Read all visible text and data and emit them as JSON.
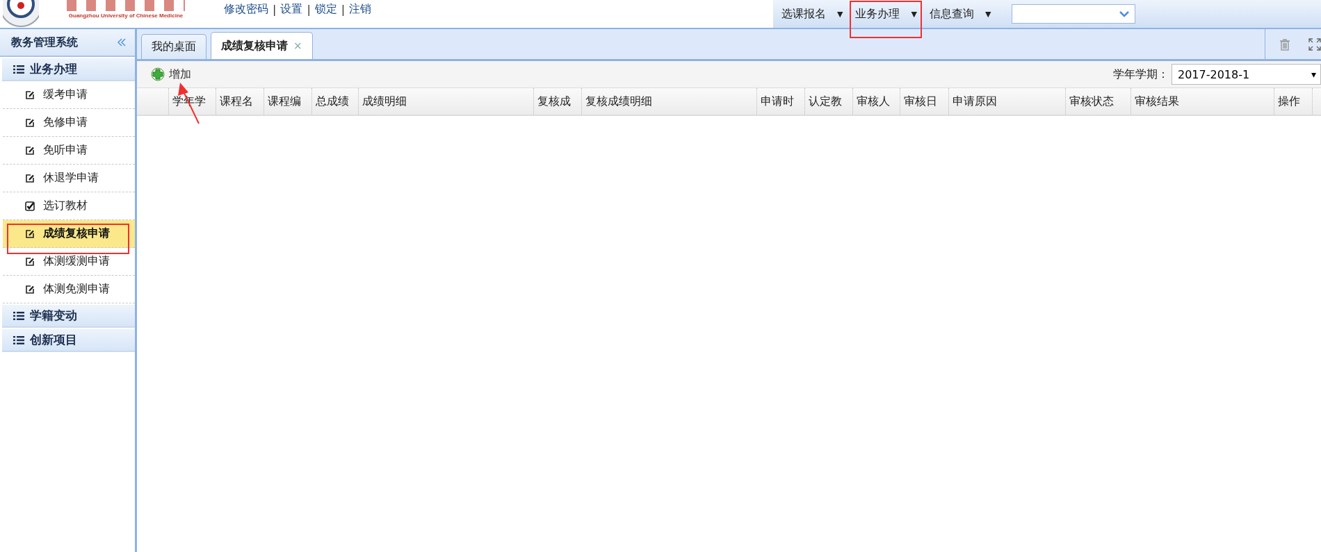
{
  "header": {
    "logo_subtitle": "Guangzhou University of Chinese Medicine",
    "links": [
      "修改密码",
      "设置",
      "锁定",
      "注销"
    ],
    "link_separator": "|",
    "menus": [
      {
        "label": "选课报名",
        "caret": "▼"
      },
      {
        "label": "业务办理",
        "caret": "▼"
      },
      {
        "label": "信息查询",
        "caret": "▼"
      }
    ]
  },
  "sidebar": {
    "title": "教务管理系统",
    "groups": [
      {
        "label": "业务办理",
        "items": [
          {
            "label": "缓考申请",
            "kind": "edit",
            "selected": false
          },
          {
            "label": "免修申请",
            "kind": "edit",
            "selected": false
          },
          {
            "label": "免听申请",
            "kind": "edit",
            "selected": false
          },
          {
            "label": "休退学申请",
            "kind": "edit",
            "selected": false
          },
          {
            "label": "选订教材",
            "kind": "check",
            "selected": false
          },
          {
            "label": "成绩复核申请",
            "kind": "edit",
            "selected": true
          },
          {
            "label": "体测缓测申请",
            "kind": "edit",
            "selected": false
          },
          {
            "label": "体测免测申请",
            "kind": "edit",
            "selected": false
          }
        ]
      },
      {
        "label": "学籍变动"
      },
      {
        "label": "创新项目"
      }
    ]
  },
  "tabs": [
    {
      "label": "我的桌面",
      "selected": false
    },
    {
      "label": "成绩复核申请",
      "selected": true,
      "close": "×"
    }
  ],
  "toolbar": {
    "add_button": "增加",
    "term_label": "学年学期：",
    "term_value": "2017-2018-1",
    "term_caret": "▾"
  },
  "table": {
    "columns": [
      "学年学",
      "课程名",
      "课程编",
      "总成绩",
      "成绩明细",
      "复核成",
      "复核成绩明细",
      "申请时",
      "认定教",
      "审核人",
      "审核日",
      "申请原因",
      "审核状态",
      "审核结果",
      "操作"
    ]
  }
}
